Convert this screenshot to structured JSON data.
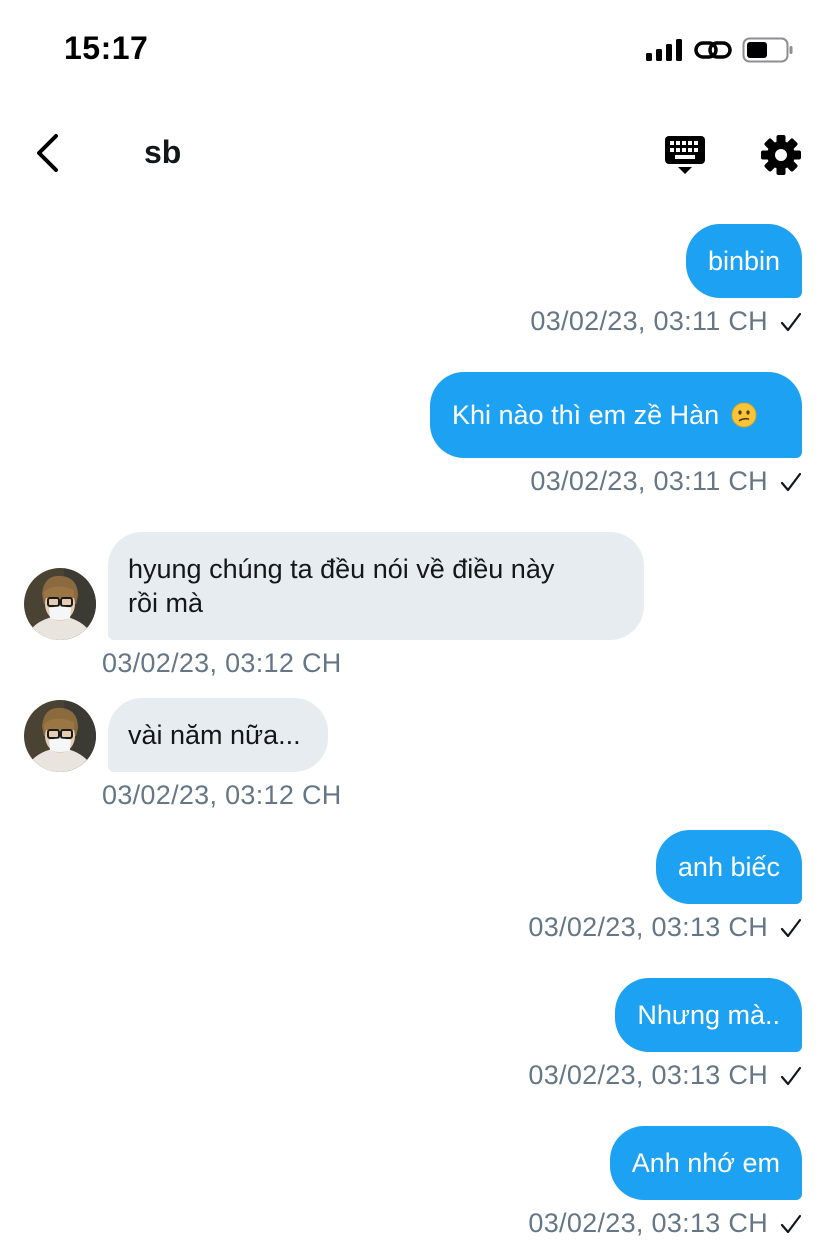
{
  "status_bar": {
    "time": "15:17"
  },
  "header": {
    "title": "sb",
    "icons": [
      "back-icon",
      "keyboard-icon",
      "gear-icon"
    ]
  },
  "colors": {
    "outgoing_bubble": "#1da1f2",
    "incoming_bubble": "#e6ecf0",
    "timestamp": "#657786",
    "text": "#14171a"
  },
  "messages": [
    {
      "direction": "out",
      "text": "binbin",
      "timestamp": "03/02/23, 03:11 CH",
      "status": "sent"
    },
    {
      "direction": "out",
      "text": "Khi nào thì em zề Hàn",
      "emoji": "confused-face",
      "timestamp": "03/02/23, 03:11 CH",
      "status": "sent"
    },
    {
      "direction": "in",
      "text_line1": "hyung chúng ta đều nói về điều này",
      "text_line2": "rồi mà",
      "timestamp": "03/02/23, 03:12 CH"
    },
    {
      "direction": "in",
      "text": "vài năm nữa...",
      "timestamp": "03/02/23, 03:12 CH"
    },
    {
      "direction": "out",
      "text": "anh biếc",
      "timestamp": "03/02/23, 03:13 CH",
      "status": "sent"
    },
    {
      "direction": "out",
      "text": "Nhưng mà..",
      "timestamp": "03/02/23, 03:13 CH",
      "status": "sent"
    },
    {
      "direction": "out",
      "text": "Anh nhớ em",
      "timestamp": "03/02/23, 03:13 CH",
      "status": "sent"
    }
  ]
}
